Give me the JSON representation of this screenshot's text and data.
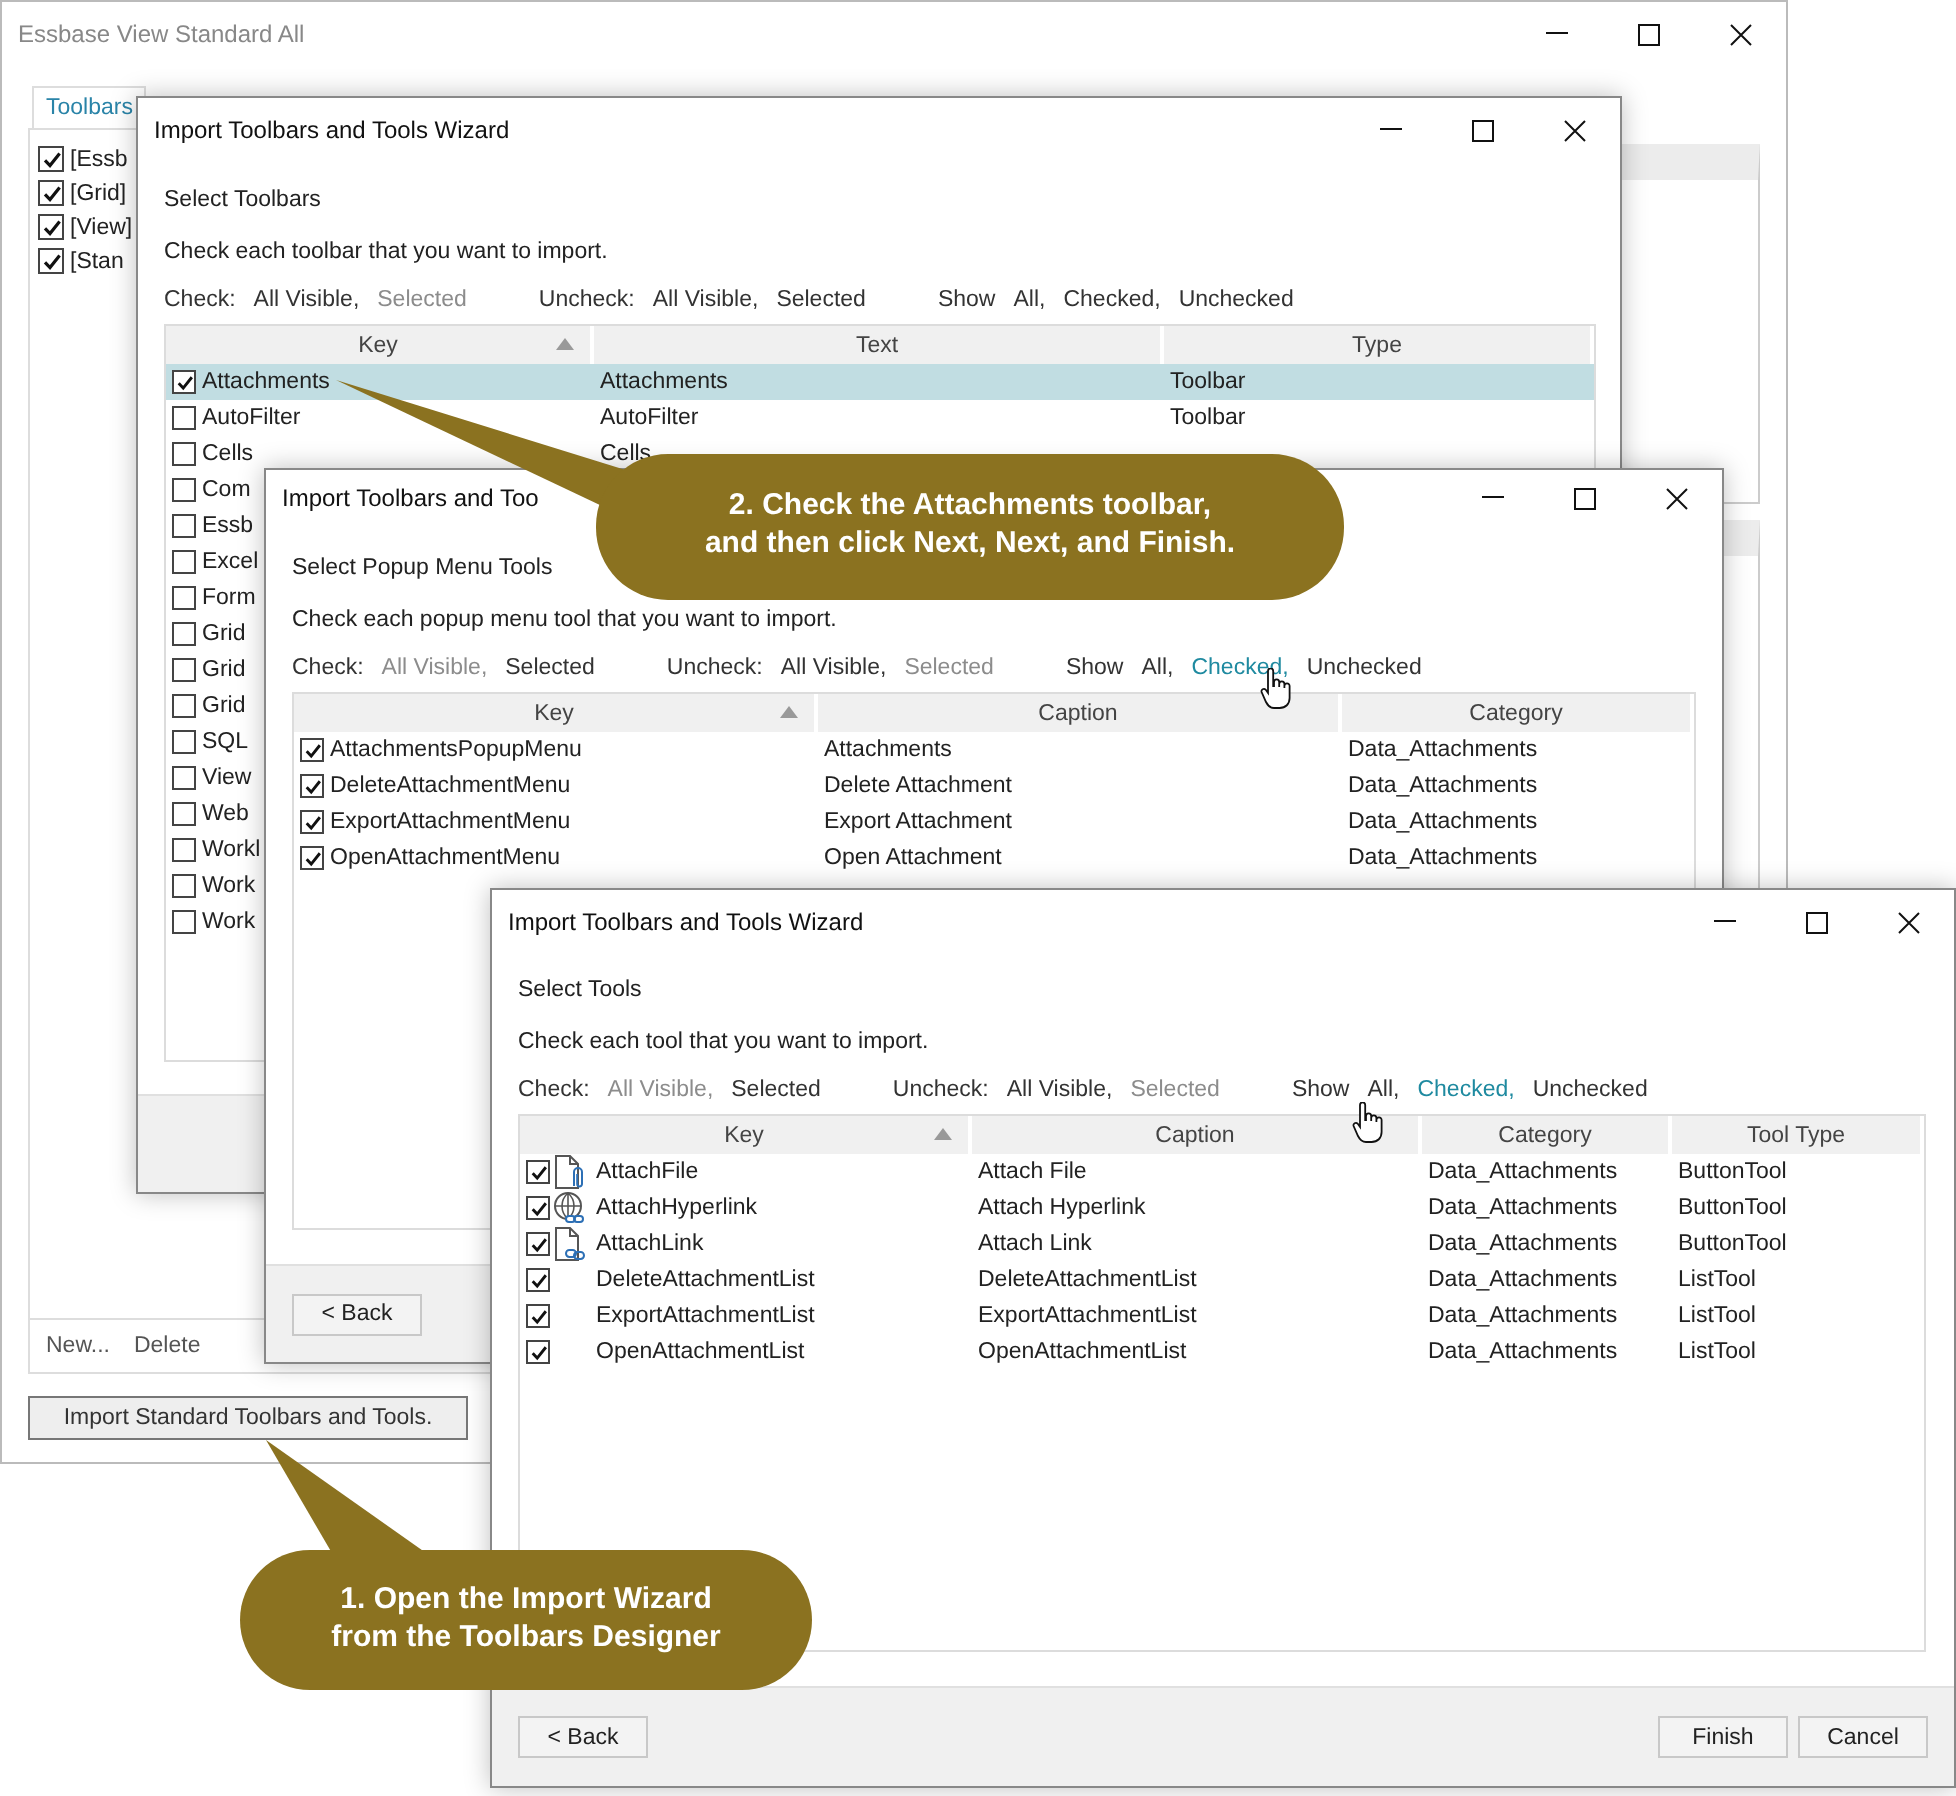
{
  "designer_window": {
    "title": "Essbase View Standard All",
    "tabs": [
      {
        "label": "Toolbars",
        "selected": true
      }
    ],
    "toolbars": [
      {
        "label": "[Essb",
        "checked": true
      },
      {
        "label": "[Grid]",
        "checked": true
      },
      {
        "label": "[View]",
        "checked": true
      },
      {
        "label": "[Stan",
        "checked": true
      }
    ],
    "footer_links": [
      "New...",
      "Delete"
    ],
    "import_button": "Import Standard Toolbars and Tools."
  },
  "wizards": [
    {
      "title": "Import Toolbars and Tools Wizard",
      "step": "Select Toolbars",
      "instruction": "Check each toolbar that you want to import.",
      "filters": [
        {
          "label": "Check:",
          "links": [
            {
              "text": "All Visible,",
              "disabled": false,
              "highlighted": false
            },
            {
              "text": "Selected",
              "disabled": true,
              "highlighted": false
            }
          ]
        },
        {
          "label": "Uncheck:",
          "links": [
            {
              "text": "All Visible,",
              "disabled": false,
              "highlighted": false
            },
            {
              "text": "Selected",
              "disabled": false,
              "highlighted": false
            }
          ]
        },
        {
          "label": "Show",
          "links": [
            {
              "text": "All,",
              "disabled": false,
              "highlighted": false
            },
            {
              "text": "Checked,",
              "disabled": false,
              "highlighted": false
            },
            {
              "text": "Unchecked",
              "disabled": false,
              "highlighted": false
            }
          ]
        }
      ],
      "columns": [
        {
          "label": "Key",
          "sorted": true
        },
        {
          "label": "Text",
          "sorted": false
        },
        {
          "label": "Type",
          "sorted": false
        }
      ],
      "rows": [
        {
          "checked": true,
          "selected": true,
          "cells": [
            "Attachments",
            "Attachments",
            "Toolbar"
          ]
        },
        {
          "checked": false,
          "selected": false,
          "cells": [
            "AutoFilter",
            "AutoFilter",
            "Toolbar"
          ]
        },
        {
          "checked": false,
          "selected": false,
          "cells": [
            "Cells",
            "Cells"
          ]
        },
        {
          "checked": false,
          "selected": false,
          "cells": [
            "Com"
          ]
        },
        {
          "checked": false,
          "selected": false,
          "cells": [
            "Essb"
          ]
        },
        {
          "checked": false,
          "selected": false,
          "cells": [
            "Excel"
          ]
        },
        {
          "checked": false,
          "selected": false,
          "cells": [
            "Form"
          ]
        },
        {
          "checked": false,
          "selected": false,
          "cells": [
            "Grid"
          ]
        },
        {
          "checked": false,
          "selected": false,
          "cells": [
            "Grid"
          ]
        },
        {
          "checked": false,
          "selected": false,
          "cells": [
            "Grid"
          ]
        },
        {
          "checked": false,
          "selected": false,
          "cells": [
            "SQL"
          ]
        },
        {
          "checked": false,
          "selected": false,
          "cells": [
            "View"
          ]
        },
        {
          "checked": false,
          "selected": false,
          "cells": [
            "Web"
          ]
        },
        {
          "checked": false,
          "selected": false,
          "cells": [
            "Workl"
          ]
        },
        {
          "checked": false,
          "selected": false,
          "cells": [
            "Work"
          ]
        },
        {
          "checked": false,
          "selected": false,
          "cells": [
            "Work"
          ]
        }
      ]
    },
    {
      "title": "Import Toolbars and Too",
      "step": "Select Popup Menu Tools",
      "instruction": "Check each popup menu tool that you want to import.",
      "filters": [
        {
          "label": "Check:",
          "links": [
            {
              "text": "All Visible,",
              "disabled": true,
              "highlighted": false
            },
            {
              "text": "Selected",
              "disabled": false,
              "highlighted": false
            }
          ]
        },
        {
          "label": "Uncheck:",
          "links": [
            {
              "text": "All Visible,",
              "disabled": false,
              "highlighted": false
            },
            {
              "text": "Selected",
              "disabled": true,
              "highlighted": false
            }
          ]
        },
        {
          "label": "Show",
          "links": [
            {
              "text": "All,",
              "disabled": false,
              "highlighted": false
            },
            {
              "text": "Checked,",
              "disabled": false,
              "highlighted": true
            },
            {
              "text": "Unchecked",
              "disabled": false,
              "highlighted": false
            }
          ]
        }
      ],
      "columns": [
        {
          "label": "Key",
          "sorted": true
        },
        {
          "label": "Caption",
          "sorted": false
        },
        {
          "label": "Category",
          "sorted": false
        }
      ],
      "rows": [
        {
          "checked": true,
          "selected": false,
          "cells": [
            "AttachmentsPopupMenu",
            "Attachments",
            "Data_Attachments"
          ]
        },
        {
          "checked": true,
          "selected": false,
          "cells": [
            "DeleteAttachmentMenu",
            "Delete Attachment",
            "Data_Attachments"
          ]
        },
        {
          "checked": true,
          "selected": false,
          "cells": [
            "ExportAttachmentMenu",
            "Export Attachment",
            "Data_Attachments"
          ]
        },
        {
          "checked": true,
          "selected": false,
          "cells": [
            "OpenAttachmentMenu",
            "Open Attachment",
            "Data_Attachments"
          ]
        }
      ],
      "buttons": [
        "< Back"
      ]
    },
    {
      "title": "Import Toolbars and Tools Wizard",
      "step": "Select Tools",
      "instruction": "Check each tool that you want to import.",
      "filters": [
        {
          "label": "Check:",
          "links": [
            {
              "text": "All Visible,",
              "disabled": true,
              "highlighted": false
            },
            {
              "text": "Selected",
              "disabled": false,
              "highlighted": false
            }
          ]
        },
        {
          "label": "Uncheck:",
          "links": [
            {
              "text": "All Visible,",
              "disabled": false,
              "highlighted": false
            },
            {
              "text": "Selected",
              "disabled": true,
              "highlighted": false
            }
          ]
        },
        {
          "label": "Show",
          "links": [
            {
              "text": "All,",
              "disabled": false,
              "highlighted": false
            },
            {
              "text": "Checked,",
              "disabled": false,
              "highlighted": true
            },
            {
              "text": "Unchecked",
              "disabled": false,
              "highlighted": false
            }
          ]
        }
      ],
      "columns": [
        {
          "label": "Key",
          "sorted": true
        },
        {
          "label": "Caption",
          "sorted": false
        },
        {
          "label": "Category",
          "sorted": false
        },
        {
          "label": "Tool Type",
          "sorted": false
        }
      ],
      "rows": [
        {
          "checked": true,
          "selected": false,
          "kind": "icon",
          "cells": [
            "AttachFile",
            "Attach File",
            "Data_Attachments",
            "ButtonTool"
          ]
        },
        {
          "checked": true,
          "selected": false,
          "kind": "icon",
          "cells": [
            "AttachHyperlink",
            "Attach Hyperlink",
            "Data_Attachments",
            "ButtonTool"
          ]
        },
        {
          "checked": true,
          "selected": false,
          "kind": "icon",
          "cells": [
            "AttachLink",
            "Attach Link",
            "Data_Attachments",
            "ButtonTool"
          ]
        },
        {
          "checked": true,
          "selected": false,
          "kind": "plain",
          "cells": [
            "DeleteAttachmentList",
            "DeleteAttachmentList",
            "Data_Attachments",
            "ListTool"
          ]
        },
        {
          "checked": true,
          "selected": false,
          "kind": "plain",
          "cells": [
            "ExportAttachmentList",
            "ExportAttachmentList",
            "Data_Attachments",
            "ListTool"
          ]
        },
        {
          "checked": true,
          "selected": false,
          "kind": "plain",
          "cells": [
            "OpenAttachmentList",
            "OpenAttachmentList",
            "Data_Attachments",
            "ListTool"
          ]
        }
      ],
      "buttons": [
        "< Back",
        "Finish",
        "Cancel"
      ]
    }
  ],
  "callouts": [
    {
      "lines": [
        "2. Check the Attachments toolbar,",
        "and then click Next, Next, and Finish."
      ]
    },
    {
      "lines": [
        "1. Open the Import Wizard",
        "from the Toolbars Designer"
      ]
    }
  ]
}
